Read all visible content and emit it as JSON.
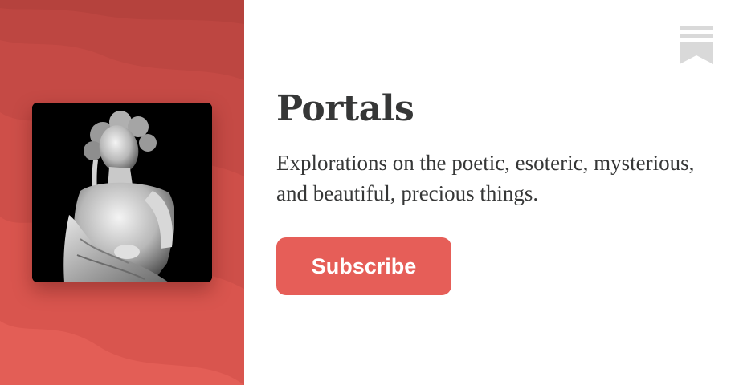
{
  "publication": {
    "name": "Portals",
    "description": "Explorations on the poetic, esoteric, mysterious, and beautiful, precious things.",
    "subscribe_label": "Subscribe",
    "cover_image": "marble-statue-woman",
    "logo_icon": "substack-bookmark-icon"
  },
  "colors": {
    "brand": "#e35e56",
    "button": "#e65e58",
    "text": "#363737",
    "logo": "#d9d9d9",
    "background": "#ffffff"
  }
}
